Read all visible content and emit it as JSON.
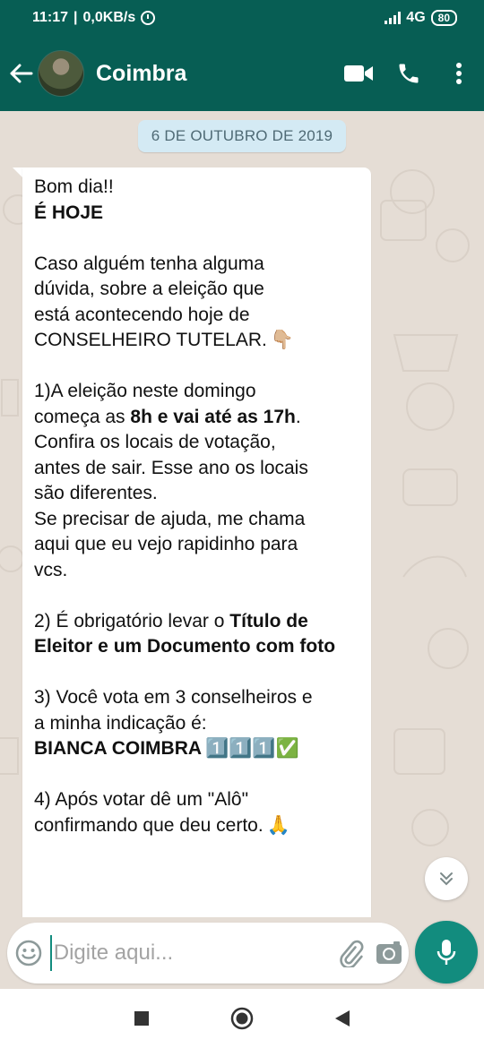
{
  "status_bar": {
    "time": "11:17",
    "speed": "0,0KB/s",
    "network": "4G",
    "battery": "80"
  },
  "header": {
    "contact_name": "Coimbra",
    "icons": [
      "back-arrow-icon",
      "video-call-icon",
      "phone-icon",
      "more-vert-icon"
    ]
  },
  "chat": {
    "date_chip": "6 DE OUTUBRO DE 2019",
    "message_lines": [
      {
        "t": "Bom dia!!"
      },
      {
        "t": "É HOJE",
        "b": true
      },
      {
        "t": ""
      },
      {
        "t": "Caso alguém tenha alguma"
      },
      {
        "t": "dúvida, sobre a eleição que"
      },
      {
        "t": "está acontecendo hoje de"
      },
      {
        "t": "CONSELHEIRO TUTELAR.",
        "emoji": "👇🏼"
      },
      {
        "t": ""
      },
      {
        "t": "1)A eleição neste domingo"
      },
      {
        "parts": [
          {
            "t": "começa as "
          },
          {
            "t": "8h e vai até as 17h",
            "b": true
          },
          {
            "t": "."
          }
        ]
      },
      {
        "t": "Confira os locais de votação,"
      },
      {
        "t": "antes de sair. Esse ano os locais"
      },
      {
        "t": "são diferentes."
      },
      {
        "t": "Se precisar de ajuda, me chama"
      },
      {
        "t": "aqui que eu vejo rapidinho para"
      },
      {
        "t": "vcs."
      },
      {
        "t": ""
      },
      {
        "parts": [
          {
            "t": "2) É obrigatório levar o "
          },
          {
            "t": "Título de",
            "b": true
          }
        ]
      },
      {
        "t": "Eleitor e um Documento com foto",
        "b": true
      },
      {
        "t": ""
      },
      {
        "t": "3) Você vota em 3 conselheiros e"
      },
      {
        "t": "a minha indicação é:"
      },
      {
        "t": "BIANCA  COIMBRA",
        "b": true,
        "emoji": "1️⃣1️⃣1️⃣✅"
      },
      {
        "t": ""
      },
      {
        "t": "4) Após votar dê um \"Alô\""
      },
      {
        "t": "confirmando que deu certo.",
        "emoji": "🙏"
      }
    ]
  },
  "composer": {
    "placeholder": "Digite aqui...",
    "value": ""
  },
  "colors": {
    "header": "#075e54",
    "accent": "#128c7e",
    "chat_bg": "#e5ddd5",
    "date_chip_bg": "#d4eaf4"
  }
}
